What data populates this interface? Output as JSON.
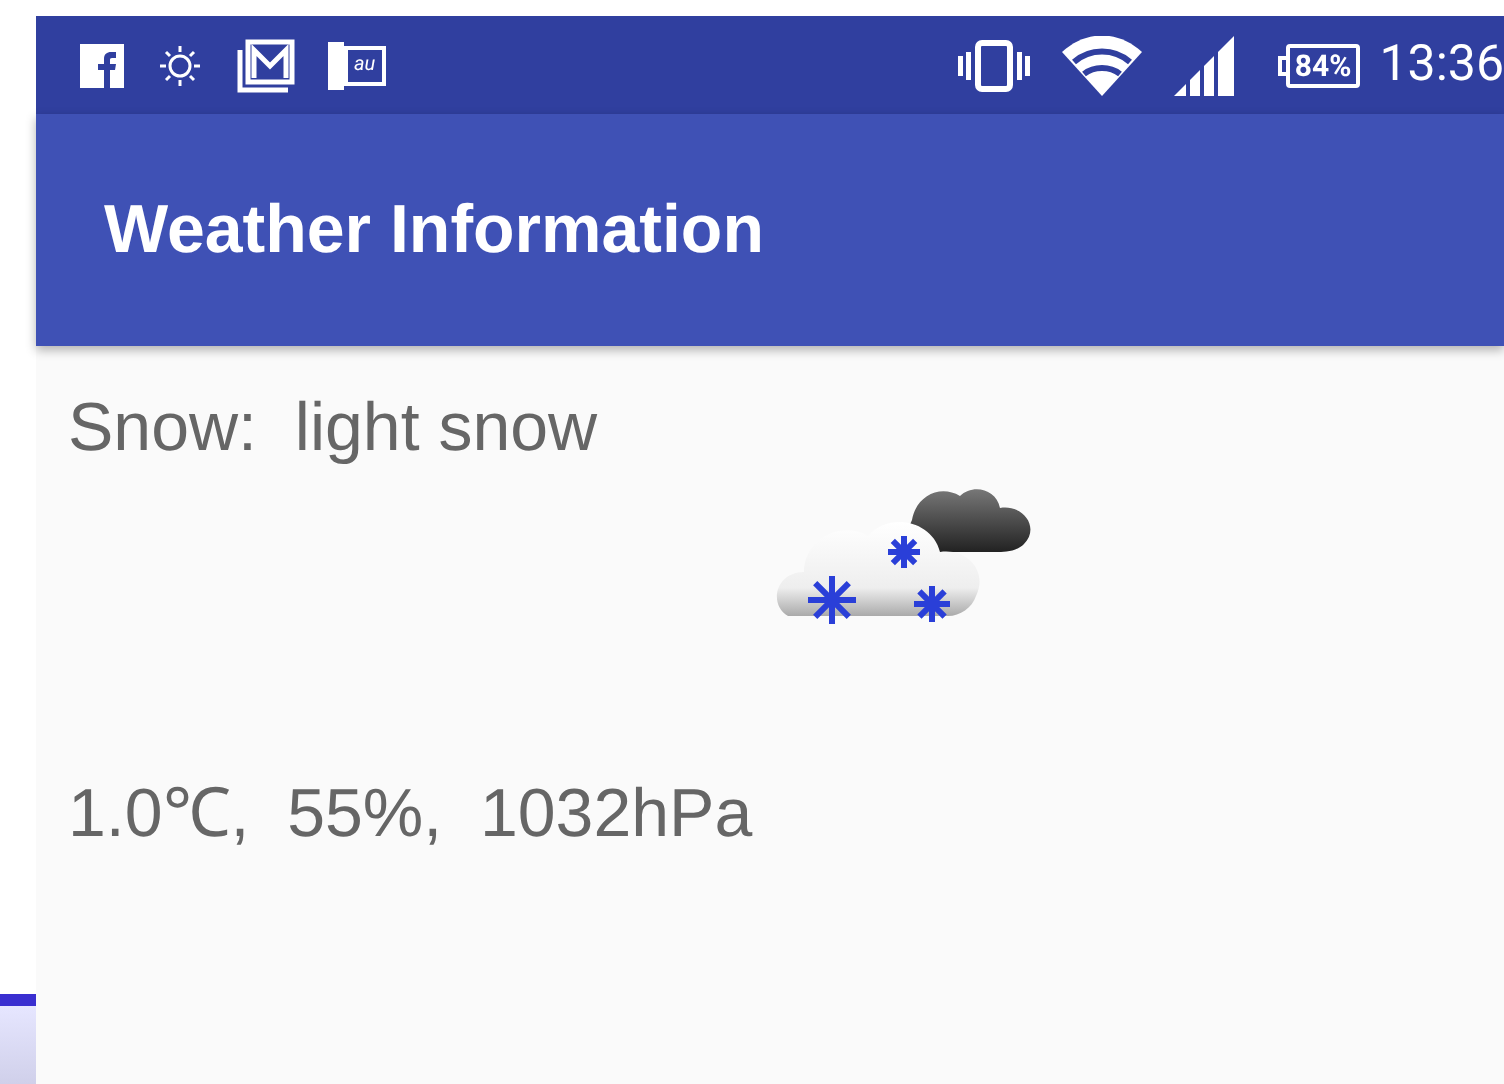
{
  "status_bar": {
    "notification_badge": "au",
    "battery": "84%",
    "time": "13:36"
  },
  "app_bar": {
    "title": "Weather Information"
  },
  "weather": {
    "summary": "Snow:  light snow",
    "readings": "1.0℃,  55%,  1032hPa"
  }
}
